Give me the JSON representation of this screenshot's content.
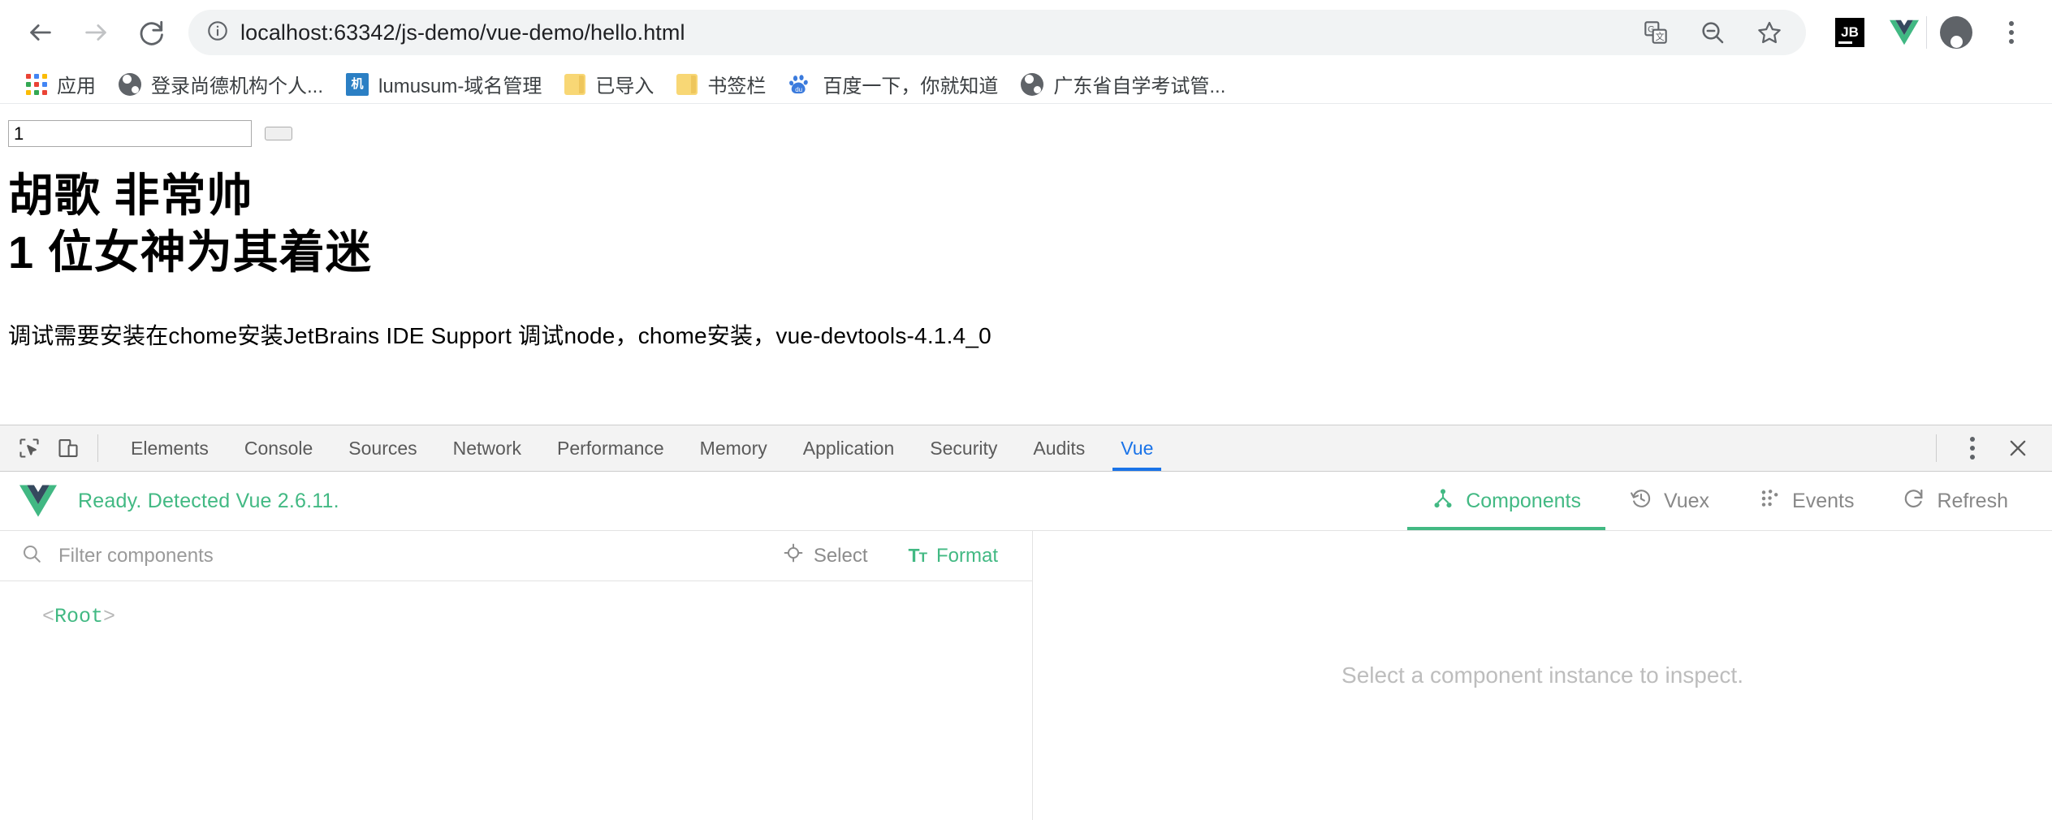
{
  "browser": {
    "back_label": "Back",
    "forward_label": "Forward",
    "reload_label": "Reload",
    "site_info_label": "View site information",
    "url": "localhost:63342/js-demo/vue-demo/hello.html",
    "toolbar_icons": [
      {
        "name": "translate-icon",
        "label": "Translate this page"
      },
      {
        "name": "zoom-out-icon",
        "label": "Zoom out"
      },
      {
        "name": "bookmark-star-icon",
        "label": "Bookmark this tab"
      }
    ],
    "extensions": [
      {
        "name": "jetbrains-ide-support-extension-icon",
        "label": "JB"
      },
      {
        "name": "vue-devtools-extension-icon",
        "label": "Vue.js devtools"
      }
    ],
    "profile_label": "Profile",
    "menu_label": "Customize and control Google Chrome"
  },
  "bookmarks": [
    {
      "label": "应用",
      "icon": "apps-grid-icon"
    },
    {
      "label": "登录尚德机构个人...",
      "icon": "globe-icon"
    },
    {
      "label": "lumusum-域名管理",
      "icon": "lumusum-site-icon"
    },
    {
      "label": "已导入",
      "icon": "folder-icon"
    },
    {
      "label": "书签栏",
      "icon": "folder-icon"
    },
    {
      "label": "百度一下，你就知道",
      "icon": "baidu-icon"
    },
    {
      "label": "广东省自学考试管...",
      "icon": "globe-icon"
    }
  ],
  "page": {
    "input_value": "1",
    "input_placeholder": "",
    "button_label": "",
    "heading_1": "胡歌 非常帅",
    "heading_2": "1 位女神为其着迷",
    "paragraph": "调试需要安装在chome安装JetBrains IDE Support 调试node，chome安装，vue-devtools-4.1.4_0"
  },
  "devtools": {
    "inspect_icon_label": "Inspect element",
    "device_toolbar_icon_label": "Toggle device toolbar",
    "tabs": [
      {
        "label": "Elements",
        "active": false
      },
      {
        "label": "Console",
        "active": false
      },
      {
        "label": "Sources",
        "active": false
      },
      {
        "label": "Network",
        "active": false
      },
      {
        "label": "Performance",
        "active": false
      },
      {
        "label": "Memory",
        "active": false
      },
      {
        "label": "Application",
        "active": false
      },
      {
        "label": "Security",
        "active": false
      },
      {
        "label": "Audits",
        "active": false
      },
      {
        "label": "Vue",
        "active": true
      }
    ],
    "more_label": "More options",
    "close_label": "Close DevTools",
    "accent_color": "#1a73e8"
  },
  "vue_panel": {
    "status": "Ready. Detected Vue 2.6.11.",
    "logo_label": "vue-logo",
    "accent_color": "#42b983",
    "nav": [
      {
        "label": "Components",
        "icon": "components-tree-icon",
        "active": true
      },
      {
        "label": "Vuex",
        "icon": "time-travel-icon",
        "active": false
      },
      {
        "label": "Events",
        "icon": "events-dots-icon",
        "active": false
      },
      {
        "label": "Refresh",
        "icon": "refresh-icon",
        "active": false
      }
    ],
    "filter_placeholder": "Filter components",
    "filter_value": "",
    "select_label": "Select",
    "format_label": "Format",
    "tree": [
      {
        "open_bracket": "<",
        "name": "Root",
        "close_bracket": ">"
      }
    ],
    "empty_message": "Select a component instance to inspect."
  }
}
